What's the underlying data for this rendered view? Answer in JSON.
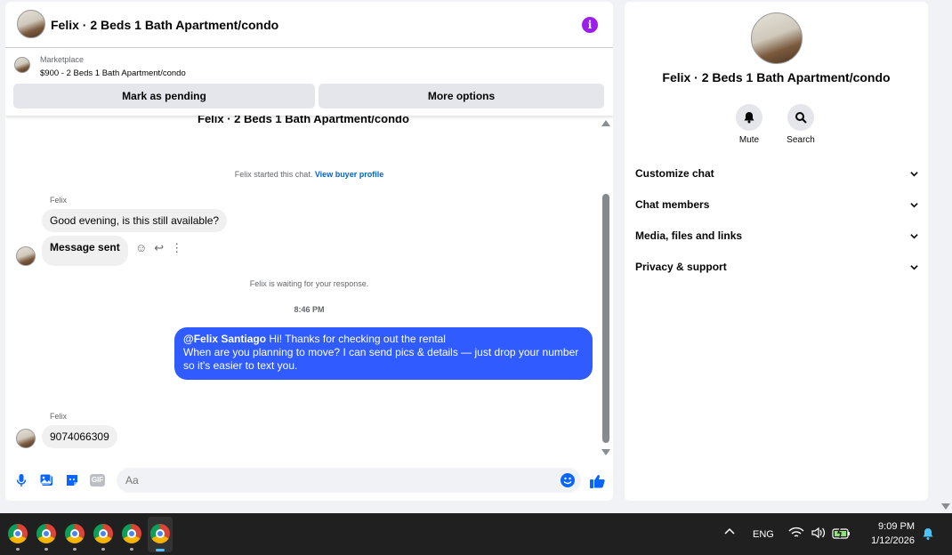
{
  "chat": {
    "title": "Felix · 2 Beds 1 Bath Apartment/condo",
    "listing": {
      "source": "Marketplace",
      "price_title": "$900 - 2 Beds 1 Bath Apartment/condo",
      "mark_pending_label": "Mark as pending",
      "more_options_label": "More options"
    },
    "partial_title": "Felix · 2 Beds 1 Bath Apartment/condo",
    "started_text": "Felix started this chat.",
    "view_profile_link": "View buyer profile",
    "messages_in_1": {
      "sender": "Felix",
      "texts": [
        "Good evening, is this still available?",
        "Message sent"
      ]
    },
    "waiting_text": "Felix is waiting for your response.",
    "timestamp": "8:46 PM",
    "outgoing": {
      "mention": "@Felix Santiago",
      "line1_rest": " Hi! Thanks for checking out the rental",
      "line2": "When are you planning to move? I can send pics & details — just drop your number",
      "line3": "so it's easier to text you."
    },
    "messages_in_2": {
      "sender": "Felix",
      "text": "9074066309"
    },
    "composer_placeholder": "Aa",
    "accent_color": "#0866ff",
    "outgoing_bubble_color": "#2f5bff"
  },
  "info": {
    "title": "Felix · 2 Beds 1 Bath Apartment/condo",
    "actions": [
      {
        "label": "Mute",
        "icon": "bell-icon"
      },
      {
        "label": "Search",
        "icon": "search-icon"
      }
    ],
    "sections": [
      "Customize chat",
      "Chat members",
      "Media, files and links",
      "Privacy & support"
    ]
  },
  "taskbar": {
    "language": "ENG",
    "time": "9:09 PM",
    "date": "1/12/2026",
    "apps": [
      "chrome-icon",
      "chrome-icon",
      "chrome-icon",
      "chrome-icon",
      "chrome-icon",
      "chrome-icon"
    ]
  }
}
